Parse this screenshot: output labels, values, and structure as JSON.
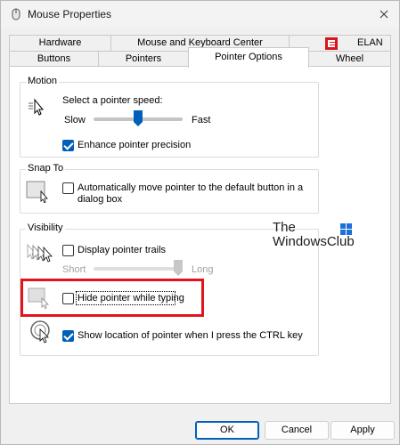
{
  "window": {
    "title": "Mouse Properties"
  },
  "tabs": {
    "row1": [
      "Hardware",
      "Mouse and Keyboard Center",
      "ELAN"
    ],
    "row2": [
      "Buttons",
      "Pointers",
      "Pointer Options",
      "Wheel"
    ],
    "active": "Pointer Options"
  },
  "motion": {
    "title": "Motion",
    "speed_label": "Select a pointer speed:",
    "slow": "Slow",
    "fast": "Fast",
    "speed_value": 0.5,
    "precision_label": "Enhance pointer precision",
    "precision_checked": true
  },
  "snap": {
    "title": "Snap To",
    "label": "Automatically move pointer to the default button in a dialog box",
    "label_line1": "Automatically move pointer to the default button in a",
    "label_line2": "dialog box",
    "checked": false
  },
  "visibility": {
    "title": "Visibility",
    "trails_label": "Display pointer trails",
    "trails_checked": false,
    "short": "Short",
    "long": "Long",
    "trail_value": 1.0,
    "hide_label": "Hide pointer while typing",
    "hide_checked": false,
    "ctrl_label": "Show location of pointer when I press the CTRL key",
    "ctrl_checked": true
  },
  "watermark": {
    "line1": "The",
    "line2": "WindowsClub"
  },
  "buttons": {
    "ok": "OK",
    "cancel": "Cancel",
    "apply": "Apply"
  },
  "colors": {
    "accent": "#005fb8",
    "highlight": "#e1141d",
    "elan": "#d9141c"
  }
}
